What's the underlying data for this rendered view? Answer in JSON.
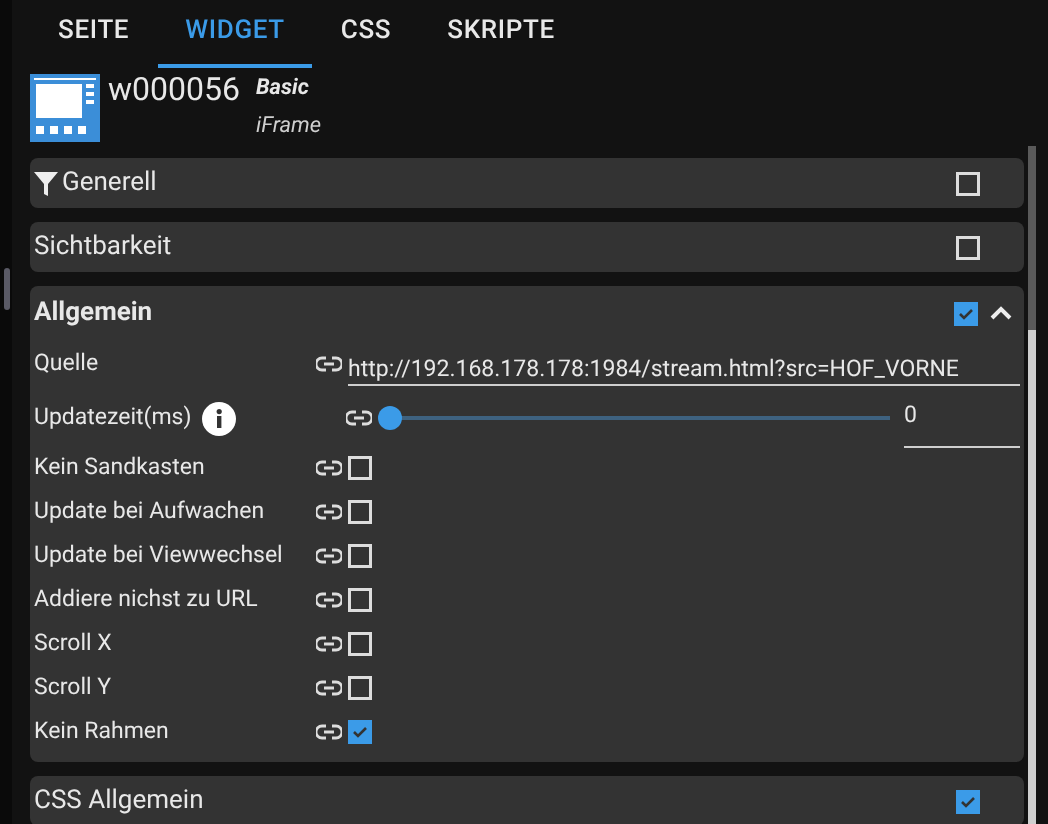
{
  "tabs": [
    {
      "label": "SEITE",
      "selected": false
    },
    {
      "label": "WIDGET",
      "selected": true
    },
    {
      "label": "CSS",
      "selected": false
    },
    {
      "label": "SKRIPTE",
      "selected": false
    }
  ],
  "widget": {
    "id": "w000056",
    "set": "Basic",
    "type": "iFrame"
  },
  "sections": [
    {
      "title": "Generell",
      "filter": true,
      "checked": false,
      "expanded": false
    },
    {
      "title": "Sichtbarkeit",
      "filter": false,
      "checked": false,
      "expanded": false
    },
    {
      "title": "Allgemein",
      "filter": false,
      "checked": true,
      "expanded": true,
      "fields": [
        {
          "kind": "text",
          "label": "Quelle",
          "value": "http://192.168.178.178:1984/stream.html?src=HOF_VORNE"
        },
        {
          "kind": "slider",
          "label": "Updatezeit(ms)",
          "info": true,
          "level": 0,
          "value": "0"
        },
        {
          "kind": "checkbox",
          "label": "Kein Sandkasten",
          "checked": false
        },
        {
          "kind": "checkbox",
          "label": "Update bei Aufwachen",
          "checked": false
        },
        {
          "kind": "checkbox",
          "label": "Update bei Viewwechsel",
          "checked": false
        },
        {
          "kind": "checkbox",
          "label": "Addiere nichst zu URL",
          "checked": false
        },
        {
          "kind": "checkbox",
          "label": "Scroll X",
          "checked": false
        },
        {
          "kind": "checkbox",
          "label": "Scroll Y",
          "checked": false
        },
        {
          "kind": "checkbox",
          "label": "Kein Rahmen",
          "checked": true
        }
      ]
    },
    {
      "title": "CSS Allgemein",
      "filter": false,
      "checked": true,
      "expanded": false
    }
  ]
}
